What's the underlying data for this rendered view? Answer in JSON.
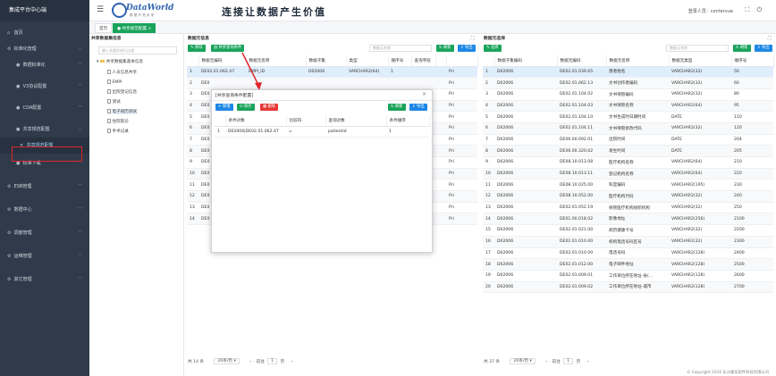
{
  "sidebar": {
    "title": "集成平台中心端",
    "items": [
      {
        "label": "首页",
        "icon": "home-icon"
      },
      {
        "label": "标准化管理",
        "icon": "standard-icon"
      },
      {
        "label": "数据标准化",
        "icon": "data-standard-icon"
      },
      {
        "label": "V3协议配置",
        "icon": "v3-protocol-icon"
      },
      {
        "label": "CDA配置",
        "icon": "cda-icon"
      },
      {
        "label": "共享规范配置",
        "icon": "share-spec-icon"
      },
      {
        "label": "共享规范配置",
        "icon": "tools-icon"
      },
      {
        "label": "标准下载",
        "icon": "download-icon"
      },
      {
        "label": "ESB管理",
        "icon": "esb-icon"
      },
      {
        "label": "数据中心",
        "icon": "datacenter-icon"
      },
      {
        "label": "调度管理",
        "icon": "schedule-icon"
      },
      {
        "label": "运维管理",
        "icon": "ops-icon"
      },
      {
        "label": "其它管理",
        "icon": "other-icon"
      }
    ]
  },
  "header": {
    "logo_text": "DataWorld",
    "logo_sub": "数 据 开 拓 未 来",
    "slogan": "连接让数据产生价值",
    "login_label": "登录人员：centervue"
  },
  "tabs": [
    {
      "label": "首页"
    },
    {
      "label": "● 共享规范配置 ×"
    }
  ],
  "tree_panel": {
    "title": "共享数据集信息",
    "search_placeholder": "输入关键字进行过滤",
    "root": "共享数据集基本信息",
    "nodes": [
      "人员信息共享",
      "EMPI",
      "出院登记信息",
      "测试",
      "电子病历测试",
      "住院就诊",
      "手术记录"
    ]
  },
  "middle_panel": {
    "title": "数据元信息",
    "btn_edit": "移除",
    "btn_share": "共享查询条件",
    "search_placeholder": "数据元名称",
    "btn_refresh": "刷新",
    "btn_export": "导出",
    "columns": [
      "",
      "数据元编码",
      "数据元名称",
      "数据子集",
      "类型",
      "顺序号",
      "查询字段",
      "",
      ""
    ],
    "rows": [
      [
        "1",
        "DE02.01.062.47",
        "EMPI_ID",
        "D02006",
        "VARCHAR2(64)",
        "1",
        "",
        "",
        "Pri"
      ],
      [
        "2",
        "DE0",
        "",
        "",
        "",
        "",
        "",
        "",
        "Pri"
      ],
      [
        "3",
        "DE0",
        "",
        "",
        "",
        "",
        "",
        "",
        "Pri"
      ],
      [
        "4",
        "DE0",
        "",
        "",
        "",
        "",
        "",
        "",
        "Pri"
      ],
      [
        "5",
        "DE0",
        "",
        "",
        "",
        "",
        "",
        "",
        "Pri"
      ],
      [
        "6",
        "DE0",
        "",
        "",
        "",
        "",
        "",
        "",
        "Pri"
      ],
      [
        "7",
        "DE0",
        "",
        "",
        "",
        "",
        "",
        "",
        "Pri"
      ],
      [
        "8",
        "DE0",
        "",
        "",
        "",
        "",
        "",
        "",
        "Pri"
      ],
      [
        "9",
        "DE0",
        "",
        "",
        "",
        "",
        "",
        "",
        "Pri"
      ],
      [
        "10",
        "DE0",
        "",
        "",
        "",
        "",
        "",
        "",
        "Pri"
      ],
      [
        "11",
        "DE0",
        "",
        "",
        "",
        "",
        "",
        "",
        "Pri"
      ],
      [
        "12",
        "DE0",
        "",
        "",
        "",
        "",
        "",
        "",
        "Pri"
      ],
      [
        "13",
        "DE0",
        "",
        "",
        "",
        "",
        "",
        "",
        "Pri"
      ],
      [
        "14",
        "DE0",
        "",
        "",
        "",
        "",
        "",
        "",
        "Pri"
      ]
    ],
    "pager": {
      "total": "共 14 条",
      "page_size": "20条/页",
      "prev": "前往",
      "page": "1",
      "unit": "页"
    }
  },
  "modal": {
    "title": "[共享查询条件配置]",
    "btn_add": "新增",
    "btn_save": "保存",
    "btn_delete": "删除",
    "btn_refresh": "刷新",
    "btn_export": "导出",
    "columns": [
      "",
      "条件对象",
      "比较符",
      "查询对象",
      "条件顺序"
    ],
    "rows": [
      [
        "1",
        "D02006|DE02.01.062.47",
        "=",
        "patientid",
        "1"
      ]
    ]
  },
  "right_panel": {
    "title": "数据元选择",
    "btn_select": "选择",
    "search_placeholder": "数据元名称",
    "btn_refresh": "刷新",
    "btn_export": "导出",
    "columns": [
      "",
      "数据子集编码",
      "数据元编码",
      "数据元名称",
      "数据元类型",
      "顺序号"
    ],
    "rows": [
      [
        "1",
        "D02006",
        "DE02.01.039.65",
        "患者姓名",
        "VARCHAR2(32)",
        "50"
      ],
      [
        "2",
        "D02006",
        "DE02.01.062.13",
        "文书创作者编码",
        "VARCHAR2(32)",
        "60"
      ],
      [
        "3",
        "D02006",
        "DE02.01.104.02",
        "文书保管编码",
        "VARCHAR2(32)",
        "80"
      ],
      [
        "4",
        "D02006",
        "DE02.01.104.03",
        "文书保管名称",
        "VARCHAR2(64)",
        "95"
      ],
      [
        "5",
        "D02006",
        "DE02.01.104.10",
        "文书生成时日期时间",
        "DATE",
        "110"
      ],
      [
        "6",
        "D02006",
        "DE02.01.104.11",
        "文书保管修改代码",
        "VARCHAR2(32)",
        "120"
      ],
      [
        "7",
        "D02006",
        "DE06.00.092.01",
        "出院时间",
        "DATE",
        "204"
      ],
      [
        "8",
        "D02006",
        "DE06.00.320.02",
        "发生时间",
        "DATE",
        "205"
      ],
      [
        "9",
        "D02006",
        "DE08.10.013.08",
        "医疗机构名称",
        "VARCHAR2(64)",
        "210"
      ],
      [
        "10",
        "D02006",
        "DE08.10.013.11",
        "登记机构名称",
        "VARCHAR2(64)",
        "220"
      ],
      [
        "11",
        "D02006",
        "DE08.10.025.00",
        "科室编码",
        "VARCHAR2(195)",
        "230"
      ],
      [
        "12",
        "D02006",
        "DE08.10.052.00",
        "医疗机构代码",
        "VARCHAR2(32)",
        "240"
      ],
      [
        "13",
        "D02006",
        "DE02.01.052.19",
        "保管医疗机构组织机构",
        "VARCHAR2(32)",
        "250"
      ],
      [
        "14",
        "D02006",
        "DE01.00.018.02",
        "影像地址",
        "VARCHAR2(256)",
        "2100"
      ],
      [
        "15",
        "D02006",
        "DE02.01.021.00",
        "病历健康卡号",
        "VARCHAR2(32)",
        "2200"
      ],
      [
        "16",
        "D02006",
        "DE02.01.010.00",
        "机构电话号码区号",
        "VARCHAR2(32)",
        "2300"
      ],
      [
        "17",
        "D02006",
        "DE02.01.010.00",
        "电话号码",
        "VARCHAR2(128)",
        "2400"
      ],
      [
        "18",
        "D02006",
        "DE02.01.012.00",
        "电子邮件地址",
        "VARCHAR2(128)",
        "2500"
      ],
      [
        "19",
        "D02006",
        "DE02.01.009.01",
        "工作单位所在地址-省(…",
        "VARCHAR2(128)",
        "2600"
      ],
      [
        "20",
        "D02006",
        "DE02.01.009.02",
        "工作单位所在地址-城市",
        "VARCHAR2(128)",
        "2700"
      ]
    ],
    "pager": {
      "total": "共 37 条",
      "page_size": "20条/页",
      "prev": "前往",
      "page": "1",
      "unit": "页"
    }
  },
  "copyright": "© Copyright 2016 长沙康乐软件科技有限公司",
  "colors": {
    "sidebar": "#2f3a4a",
    "accent": "#1aa35b",
    "primary": "#1e88e5",
    "danger": "#e53935",
    "highlight": "#e0262b"
  }
}
